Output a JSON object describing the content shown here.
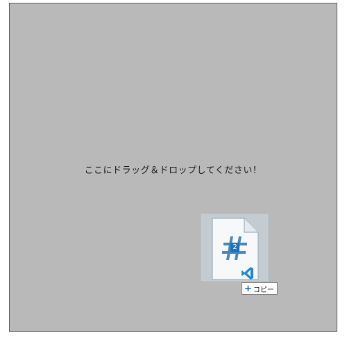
{
  "drop_zone": {
    "message": "ここにドラッグ＆ドロップしてください！",
    "background_color": "#b9b9b9"
  },
  "drag_preview": {
    "file_icon": "csharp-file-vscode-icon",
    "item_count": "2",
    "badge_color": "#1a74c4"
  },
  "drop_effect": {
    "icon": "plus-icon",
    "label": "コピー"
  }
}
